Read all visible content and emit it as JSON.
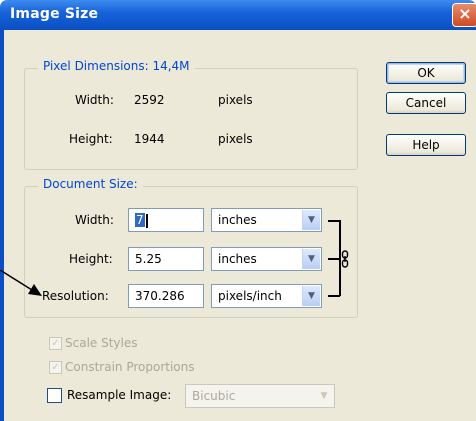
{
  "window": {
    "title": "Image Size",
    "close_glyph": "×"
  },
  "pixel_dimensions": {
    "legend": "Pixel Dimensions: 14,4M",
    "width": {
      "label": "Width:",
      "value": "2592",
      "unit": "pixels"
    },
    "height": {
      "label": "Height:",
      "value": "1944",
      "unit": "pixels"
    }
  },
  "document_size": {
    "legend": "Document Size:",
    "width": {
      "label": "Width:",
      "value": "7",
      "unit": "inches"
    },
    "height": {
      "label": "Height:",
      "value": "5.25",
      "unit": "inches"
    },
    "resolution": {
      "label": "Resolution:",
      "value": "370.286",
      "unit": "pixels/inch"
    }
  },
  "buttons": {
    "ok": "OK",
    "cancel": "Cancel",
    "help": "Help"
  },
  "options": {
    "scale_styles": {
      "label": "Scale Styles",
      "checked": true,
      "enabled": false
    },
    "constrain_proportions": {
      "label": "Constrain Proportions",
      "checked": true,
      "enabled": false
    },
    "resample_image": {
      "label": "Resample Image:",
      "checked": false,
      "enabled": true,
      "method": "Bicubic"
    }
  },
  "icons": {
    "link": "chain-link-icon",
    "dropdown": "chevron-down-icon",
    "annotation": "arrow-icon"
  }
}
